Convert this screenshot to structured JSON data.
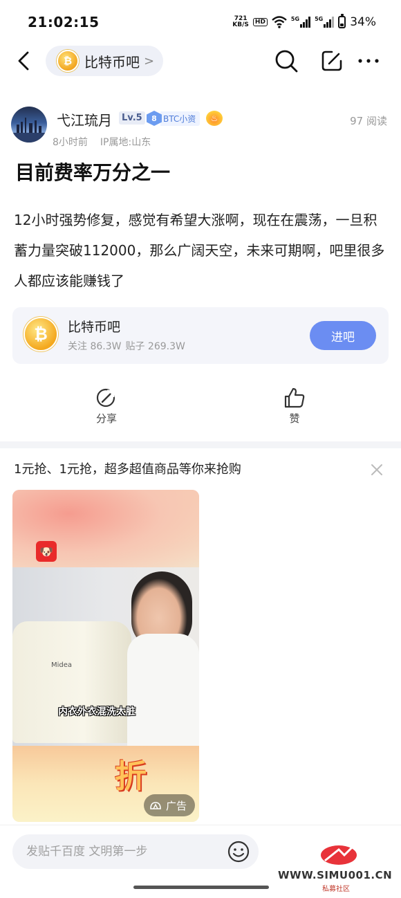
{
  "status_bar": {
    "time": "21:02:15",
    "net_speed_value": "721",
    "net_speed_unit": "KB/S",
    "hd_label": "HD",
    "sim1_label": "5G",
    "sim2_label": "5G",
    "battery": "34%",
    "battery_level": 0.34
  },
  "nav": {
    "forum_name": "比特币吧",
    "chevron": ">"
  },
  "post": {
    "author": "弋江琉月",
    "level": "Lv.5",
    "rank_number": "8",
    "rank_label": "BTC小资",
    "read_count": "97 阅读",
    "time_ago": "8小时前",
    "ip_location": "IP属地:山东",
    "title": "目前费率万分之一",
    "body": "12小时强势修复，感觉有希望大涨啊，现在在震荡，一旦积蓄力量突破112000，那么广阔天空，未来可期啊，吧里很多人都应该能赚钱了"
  },
  "forum_card": {
    "name": "比特币吧",
    "followers": "关注 86.3W",
    "posts": "贴子 269.3W",
    "join_label": "进吧"
  },
  "actions": {
    "share_label": "分享",
    "like_label": "赞"
  },
  "ad": {
    "title": "1元抢、1元抢，超多超值商品等你来抢购",
    "caption": "内衣外衣混洗太脏",
    "brand_text": "Midea",
    "badge_char": "折",
    "tag": "广告"
  },
  "bottom": {
    "comment_placeholder": "发贴千百度 文明第一步"
  },
  "watermark": {
    "url": "WWW.SIMU001.CN",
    "sub": "私募社区"
  },
  "colors": {
    "accent_blue": "#6b8df2",
    "coin_gold": "#f4a81e",
    "text_primary": "#1f1f1f",
    "text_secondary": "#999999"
  }
}
